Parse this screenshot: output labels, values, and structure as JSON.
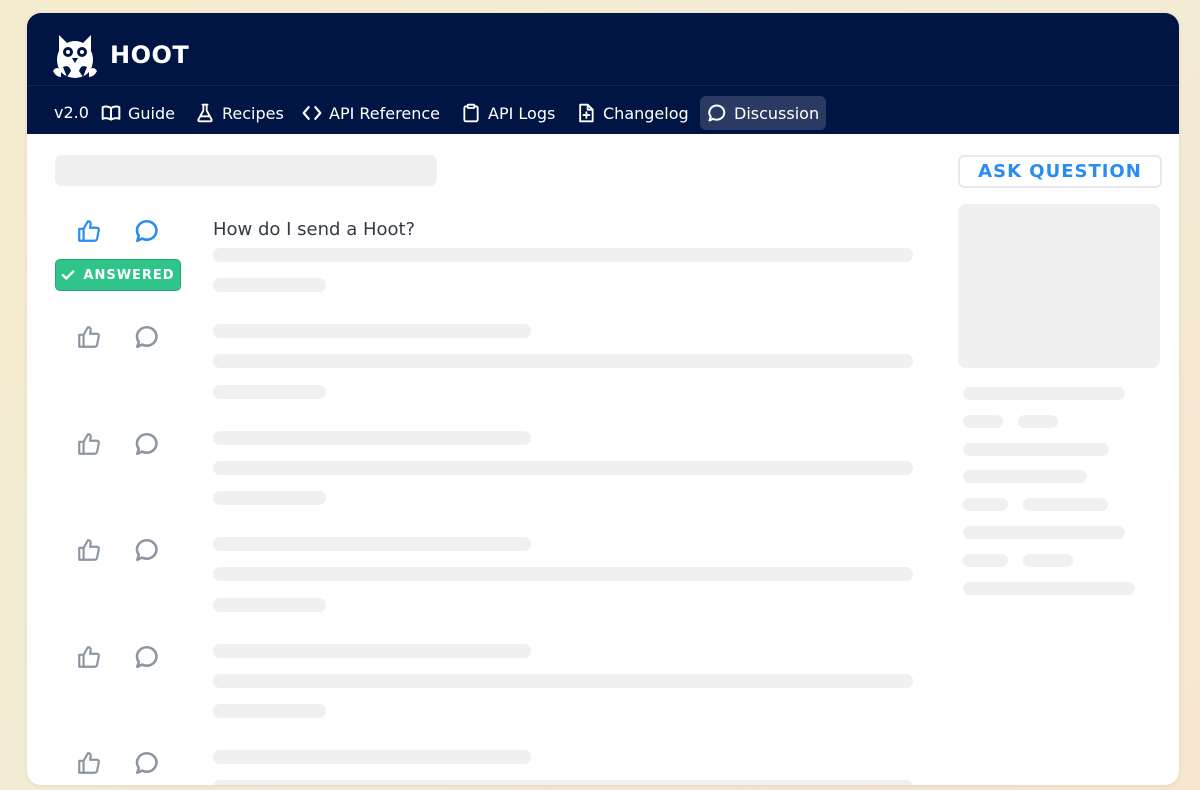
{
  "app": {
    "name": "HOOT",
    "logo_icon": "owl-logo-icon"
  },
  "nav": {
    "version": "v2.0",
    "items": [
      {
        "label": "Guide",
        "icon": "book-icon",
        "active": false
      },
      {
        "label": "Recipes",
        "icon": "flask-icon",
        "active": false
      },
      {
        "label": "API Reference",
        "icon": "code-icon",
        "active": false
      },
      {
        "label": "API Logs",
        "icon": "clipboard-icon",
        "active": false
      },
      {
        "label": "Changelog",
        "icon": "file-plus-icon",
        "active": false
      },
      {
        "label": "Discussion",
        "icon": "speech-bubble-icon",
        "active": true
      }
    ]
  },
  "discussion": {
    "ask_button_label": "ASK QUESTION",
    "first_question": {
      "title": "How do I send a Hoot?",
      "status_badge": "ANSWERED",
      "status_icon": "check-icon"
    }
  },
  "colors": {
    "header_bg": "#001544",
    "nav_active_bg": "#2a3a63",
    "accent_blue": "#2a8cf0",
    "answered_green": "#2fc48a",
    "icon_gray": "#8c96a3",
    "skeleton": "#f0f0f0"
  }
}
